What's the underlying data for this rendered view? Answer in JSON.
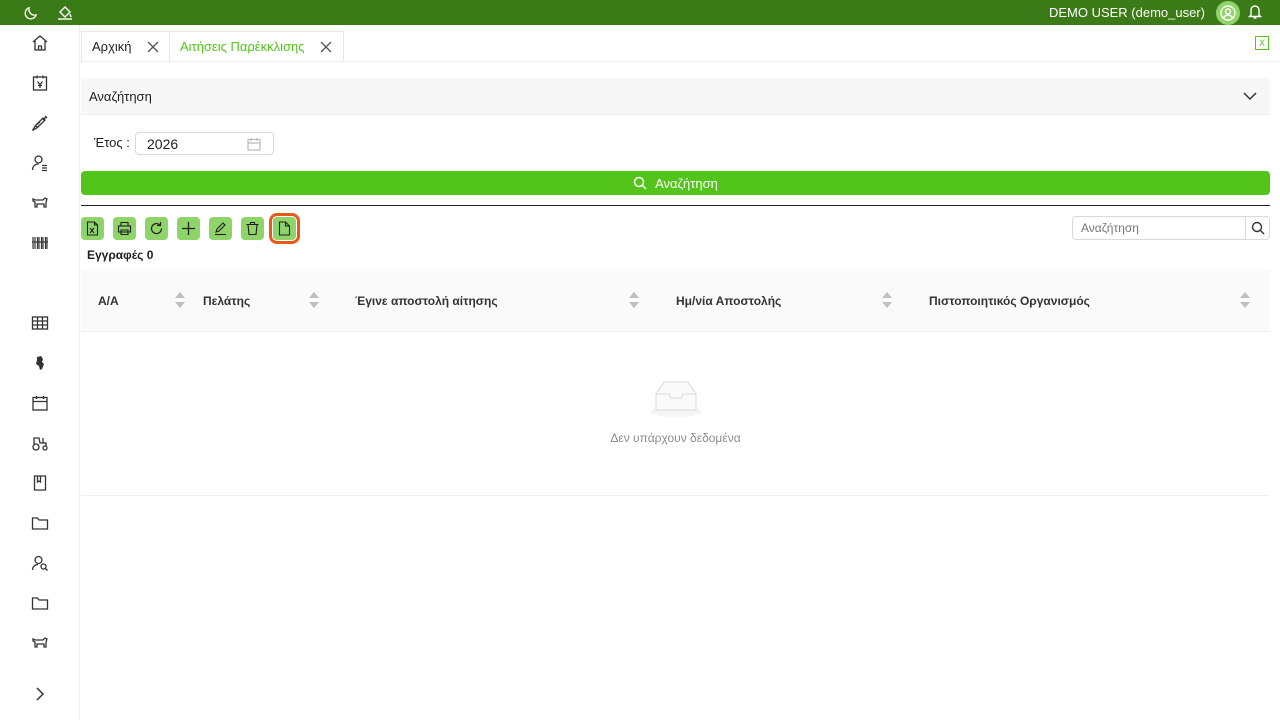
{
  "topbar": {
    "user_label": "DEMO USER (demo_user)",
    "icons": [
      "moon-icon",
      "paint-bucket-icon",
      "avatar-icon",
      "bell-icon"
    ],
    "bg_color": "#3a7a17"
  },
  "sidebar": {
    "items": [
      {
        "icon": "home-icon"
      },
      {
        "icon": "calendar-yen-icon"
      },
      {
        "icon": "syringe-icon"
      },
      {
        "icon": "user-list-icon"
      },
      {
        "icon": "cow-icon"
      },
      {
        "icon": "barcode-icon"
      },
      {
        "icon": "table-icon"
      },
      {
        "icon": "africa-map-icon"
      },
      {
        "icon": "calendar-icon"
      },
      {
        "icon": "tractor-icon"
      },
      {
        "icon": "book-icon"
      },
      {
        "icon": "folder-icon"
      },
      {
        "icon": "user-search-icon"
      },
      {
        "icon": "folder-icon"
      },
      {
        "icon": "cow-icon"
      }
    ],
    "expand_icon": "chevron-right-icon"
  },
  "tabs": [
    {
      "label": "Αρχική",
      "active": false
    },
    {
      "label": "Αιτήσεις Παρέκκλισης",
      "active": true
    }
  ],
  "search_panel": {
    "title": "Αναζήτηση",
    "year_label": "Έτος :",
    "year_value": "2026",
    "search_button": "Αναζήτηση"
  },
  "toolbar": {
    "buttons": [
      "excel-icon",
      "print-icon",
      "refresh-icon",
      "add-icon",
      "edit-icon",
      "delete-icon",
      "document-icon"
    ],
    "records_label": "Εγγραφές 0",
    "search_placeholder": "Αναζήτηση"
  },
  "table": {
    "columns": [
      "Α/Α",
      "Πελάτης",
      "Έγινε αποστολή αίτησης",
      "Ημ/νία Αποστολής",
      "Πιστοποιητικός Οργανισμός"
    ],
    "rows": [],
    "empty_text": "Δεν υπάρχουν δεδομένα"
  },
  "colors": {
    "accent": "#52c41a",
    "button_bg": "#8fd468",
    "focus": "#e8581a"
  }
}
